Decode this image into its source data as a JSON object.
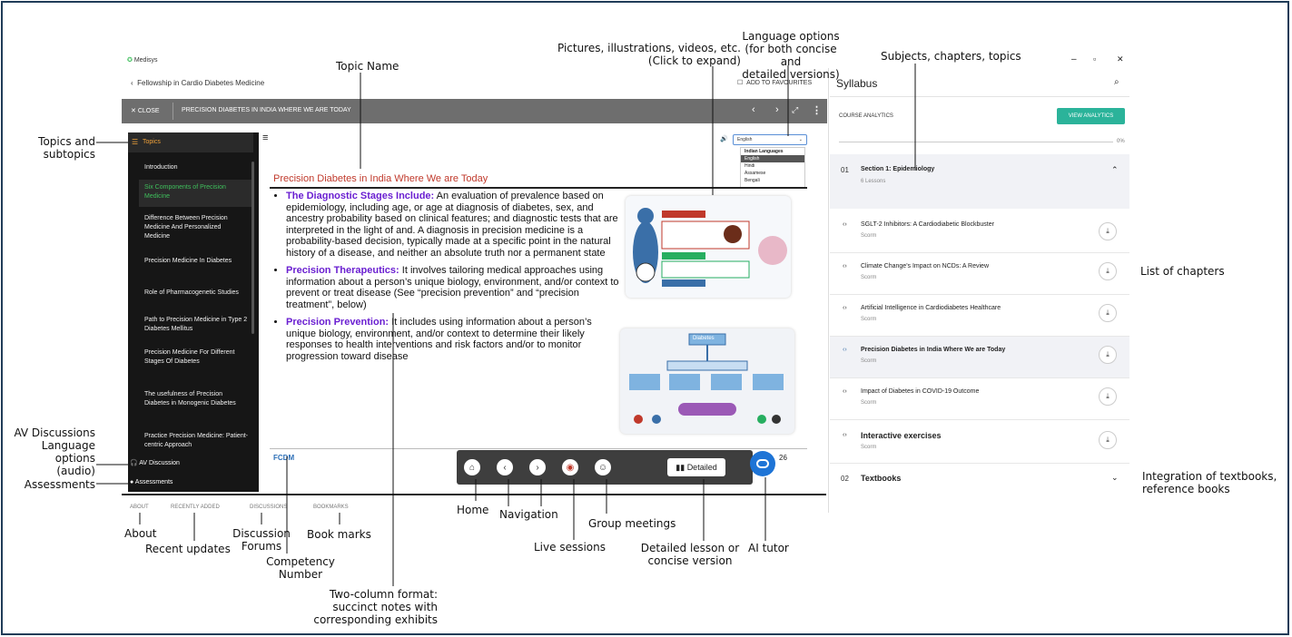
{
  "app": {
    "name": "Medisys",
    "course": "Fellowship in Cardio Diabetes Medicine",
    "favourites": "ADD TO FAVOURITES",
    "close": "CLOSE",
    "topic_bar": "PRECISION DIABETES IN INDIA WHERE WE ARE TODAY"
  },
  "sidebar": {
    "header": "Topics",
    "items": [
      {
        "label": "Introduction"
      },
      {
        "label": "Six Components of Precision Medicine"
      },
      {
        "label": "Difference Between Precision Medicine And Personalized Medicine"
      },
      {
        "label": "Precision Medicine In Diabetes"
      },
      {
        "label": "Role of Pharmacogenetic Studies"
      },
      {
        "label": "Path to Precision Medicine in Type 2 Diabetes Mellitus"
      },
      {
        "label": "Precision Medicine For Different Stages Of Diabetes"
      },
      {
        "label": "The usefulness of Precision Diabetes in Monogenic Diabetes"
      },
      {
        "label": "Practice Precision Medicine: Patient-centric Approach"
      }
    ],
    "av": "AV Discussion",
    "assessments": "Assessments"
  },
  "content": {
    "title": "Precision Diabetes in India Where We are Today",
    "bullets": [
      {
        "head": "The Diagnostic Stages Include:",
        "text": " An evaluation of prevalence based on epidemiology, including age, or age at diagnosis of diabetes, sex, and ancestry probability based on clinical features; and diagnostic tests that are interpreted in the light of and. A diagnosis in precision medicine is a probability-based decision, typically made at a specific point in the natural history of a disease, and neither an absolute truth nor a permanent state"
      },
      {
        "head": "Precision Therapeutics:",
        "text": " It involves tailoring medical approaches using information about a person’s unique biology, environment, and/or context to prevent or treat disease (See “precision prevention” and “precision treatment”, below)"
      },
      {
        "head": "Precision Prevention:",
        "text": " It includes using information about a person’s unique biology, environment, and/or context to determine their likely responses to health interventions and risk factors and/or to monitor progression toward disease"
      }
    ],
    "footer_code": "FCDM",
    "page": "26",
    "detailed": "Detailed",
    "diagram_label": "Diabetes"
  },
  "language": {
    "selected": "English",
    "group": "Indian Languages",
    "options": [
      "English",
      "Hindi",
      "Assamese",
      "Bengali"
    ]
  },
  "tabs": [
    "ABOUT",
    "RECENTLY ADDED",
    "DISCUSSIONS",
    "BOOKMARKS"
  ],
  "syllabus": {
    "title": "Syllabus",
    "analytics_label": "COURSE ANALYTICS",
    "analytics_btn": "VIEW ANALYTICS",
    "progress": "0%",
    "section1": {
      "num": "01",
      "title": "Section 1: Epidemiology",
      "sub": "6 Lessons"
    },
    "lessons": [
      {
        "title": "SGLT-2 Inhibitors: A Cardiodiabetic Blockbuster",
        "sub": "Scorm"
      },
      {
        "title": "Climate Change's Impact on NCDs: A Review",
        "sub": "Scorm"
      },
      {
        "title": "Artificial Intelligence in Cardiodiabetes Healthcare",
        "sub": "Scorm"
      },
      {
        "title": "Precision Diabetes in India Where We are Today",
        "sub": "Scorm"
      },
      {
        "title": "Impact of Diabetes in COVID-19 Outcome",
        "sub": "Scorm"
      },
      {
        "title": "Interactive exercises",
        "sub": "Scorm"
      }
    ],
    "section2": {
      "num": "02",
      "title": "Textbooks"
    }
  },
  "annotations": {
    "topic_name": "Topic Name",
    "pictures": "Pictures, illustrations, videos, etc.\n(Click to expand)",
    "language_opts": "Language options\n(for both concise and\ndetailed versions)",
    "subjects": "Subjects, chapters, topics",
    "topics_sub": "Topics and\nsubtopics",
    "av_lang": "AV Discussions\nLanguage\noptions\n(audio)",
    "assessments": "Assessments",
    "list_chapters": "List of chapters",
    "integration": "Integration of textbooks,\nreference books",
    "about": "About",
    "recent": "Recent updates",
    "discussion": "Discussion\nForums",
    "bookmarks": "Book marks",
    "competency": "Competency\nNumber",
    "two_column": "Two-column format:\nsuccinct notes with\ncorresponding exhibits",
    "home": "Home",
    "navigation": "Navigation",
    "live": "Live sessions",
    "group": "Group meetings",
    "detailed": "Detailed lesson or\nconcise version",
    "ai": "AI tutor"
  }
}
